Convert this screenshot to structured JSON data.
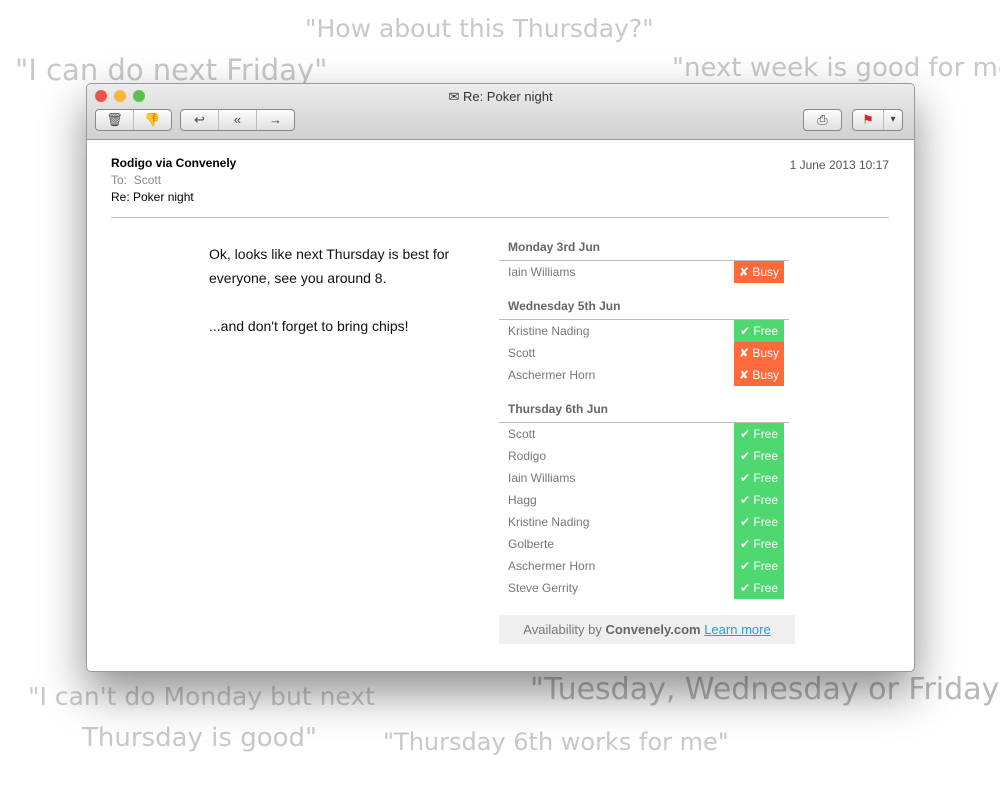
{
  "quotes": [
    "\"How about this Thursday?\"",
    "\"I can do next Friday\"",
    "\"next week is good for me\"",
    "\"I can't do Monday but next",
    "Thursday is good\"",
    "\"Tuesday, Wednesday or Friday\"",
    "\"Thursday 6th works for me\""
  ],
  "window": {
    "title": "Re: Poker night"
  },
  "toolbar": {
    "delete": "🗑",
    "junk": "👎",
    "reply": "↩",
    "reply_all": "«",
    "forward": "→",
    "print": "⎙",
    "flag": "⚑",
    "flag_menu": "▾"
  },
  "email": {
    "from": "Rodigo via Convenely",
    "to_label": "To:",
    "to": "Scott",
    "subject": "Re: Poker night",
    "date": "1 June 2013 10:17",
    "body": [
      "Ok, looks like next Thursday is best for everyone, see you around 8.",
      "...and don't forget to bring chips!"
    ]
  },
  "schedule": [
    {
      "day": "Monday 3rd Jun",
      "rows": [
        {
          "name": "Iain Williams",
          "status": "✘ Busy",
          "busy": true
        }
      ]
    },
    {
      "day": "Wednesday 5th Jun",
      "rows": [
        {
          "name": "Kristine Nading",
          "status": "✔ Free"
        },
        {
          "name": "Scott",
          "status": "✘ Busy",
          "busy": true
        },
        {
          "name": "Aschermer Horn",
          "status": "✘ Busy",
          "busy": true
        }
      ]
    },
    {
      "day": "Thursday 6th Jun",
      "rows": [
        {
          "name": "Scott",
          "status": "✔ Free"
        },
        {
          "name": "Rodigo",
          "status": "✔ Free"
        },
        {
          "name": "Iain Williams",
          "status": "✔ Free"
        },
        {
          "name": "Hagg",
          "status": "✔ Free"
        },
        {
          "name": "Kristine Nading",
          "status": "✔ Free"
        },
        {
          "name": "Golberte",
          "status": "✔ Free"
        },
        {
          "name": "Aschermer Horn",
          "status": "✔ Free"
        },
        {
          "name": "Steve Gerrity",
          "status": "✔ Free"
        }
      ]
    }
  ],
  "footer": {
    "prefix": "Availability by",
    "brand": "Convenely.com",
    "link": "Learn more"
  }
}
